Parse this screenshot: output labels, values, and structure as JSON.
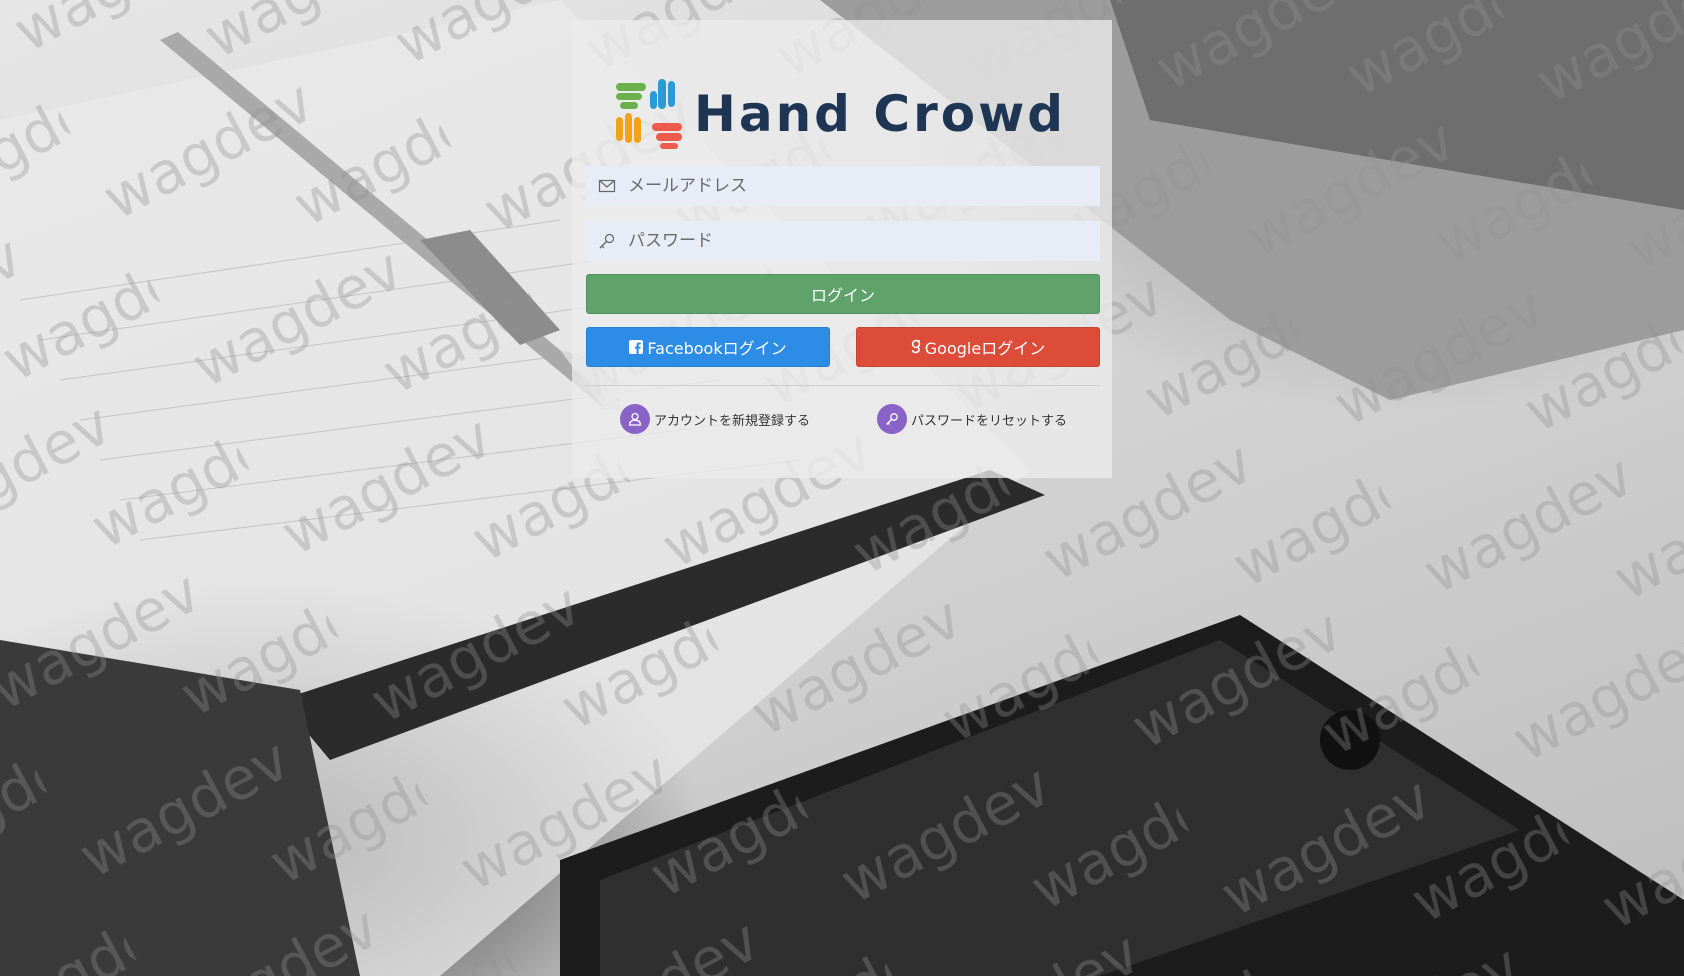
{
  "app": {
    "logo_text": "Hand Crowd",
    "watermark_text": "wagdev"
  },
  "form": {
    "email_placeholder": "メールアドレス",
    "email_value": "",
    "password_placeholder": "パスワード",
    "password_value": "",
    "login_label": "ログイン",
    "facebook_label": "Facebookログイン",
    "google_label": "Googleログイン"
  },
  "links": {
    "register_label": "アカウントを新規登録する",
    "reset_label": "パスワードをリセットする"
  },
  "icons": {
    "email": "envelope-icon",
    "password": "key-icon",
    "facebook": "facebook-icon",
    "google": "google-plus-icon",
    "register": "user-icon",
    "reset": "key-icon"
  },
  "colors": {
    "login_button": "#5fa36a",
    "facebook_button": "#2d8ce6",
    "google_button": "#dd4b39",
    "link_icon_circle": "#8a63c8",
    "logo_text": "#1e3554",
    "input_background": "#e8ecf7"
  }
}
